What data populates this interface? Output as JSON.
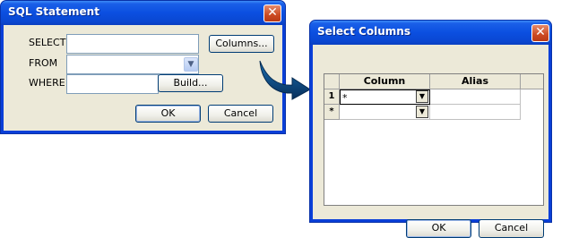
{
  "sql_dialog": {
    "title": "SQL Statement",
    "close_glyph": "✕",
    "select_label": "SELECT",
    "from_label": "FROM",
    "where_label": "WHERE",
    "select_value": "",
    "from_value": "",
    "where_value": "",
    "columns_button": "Columns...",
    "build_button": "Build...",
    "ok_button": "OK",
    "cancel_button": "Cancel"
  },
  "columns_dialog": {
    "title": "Select Columns",
    "close_glyph": "✕",
    "headers": [
      "Column",
      "Alias"
    ],
    "rows": [
      {
        "indicator": "1",
        "column": "*",
        "alias": ""
      },
      {
        "indicator": "*",
        "column": "",
        "alias": ""
      }
    ],
    "ok_button": "OK",
    "cancel_button": "Cancel"
  },
  "colors": {
    "titlebar": "#0a47d2",
    "client": "#ece9d8",
    "arrow": "#0a3f7a"
  },
  "icons": {
    "dropdown": "chevron-down-icon",
    "arrow": "curved-arrow-icon"
  }
}
